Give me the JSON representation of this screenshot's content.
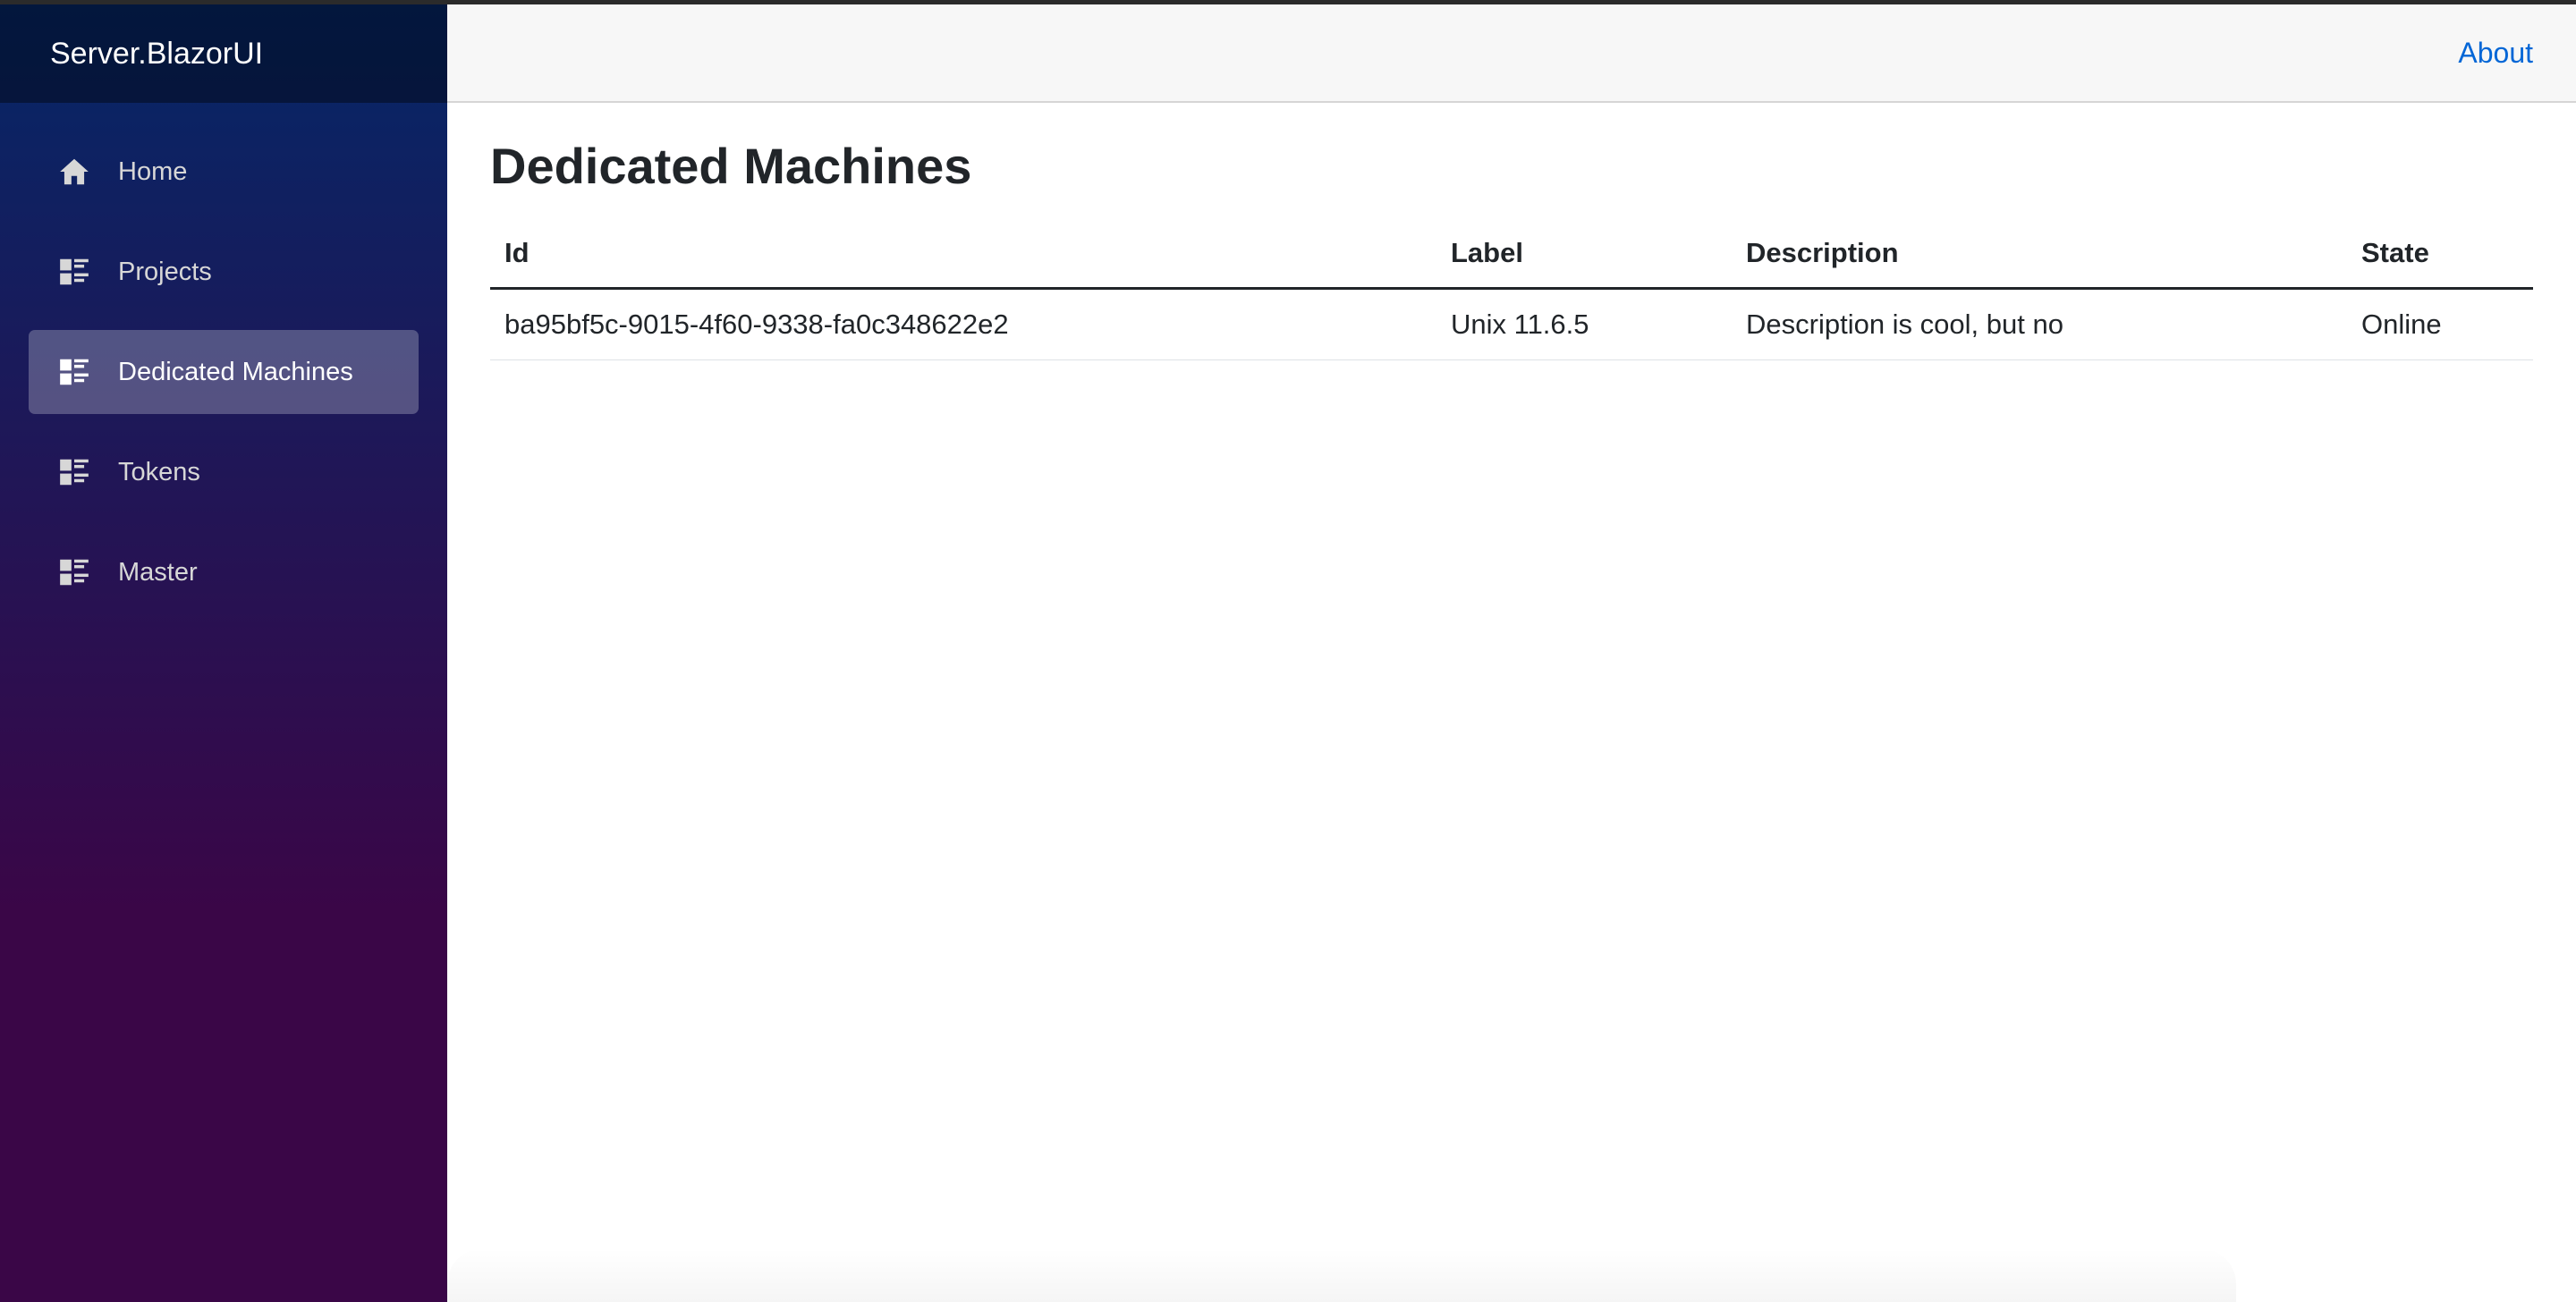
{
  "app": {
    "brand": "Server.BlazorUI"
  },
  "sidebar": {
    "items": [
      {
        "label": "Home",
        "icon": "home-icon",
        "active": false
      },
      {
        "label": "Projects",
        "icon": "list-icon",
        "active": false
      },
      {
        "label": "Dedicated Machines",
        "icon": "list-icon",
        "active": true
      },
      {
        "label": "Tokens",
        "icon": "list-icon",
        "active": false
      },
      {
        "label": "Master",
        "icon": "list-icon",
        "active": false
      }
    ]
  },
  "header": {
    "about_label": "About"
  },
  "page": {
    "title": "Dedicated Machines"
  },
  "table": {
    "columns": [
      "Id",
      "Label",
      "Description",
      "State"
    ],
    "rows": [
      {
        "id": "ba95bf5c-9015-4f60-9338-fa0c348622e2",
        "label": "Unix 11.6.5",
        "description": "Description is cool, but no",
        "state": "Online"
      }
    ]
  },
  "colors": {
    "sidebar_top": "#052767",
    "sidebar_bottom": "#3a0647",
    "link": "#0366d6",
    "active_item_bg": "rgba(255,255,255,0.25)"
  }
}
